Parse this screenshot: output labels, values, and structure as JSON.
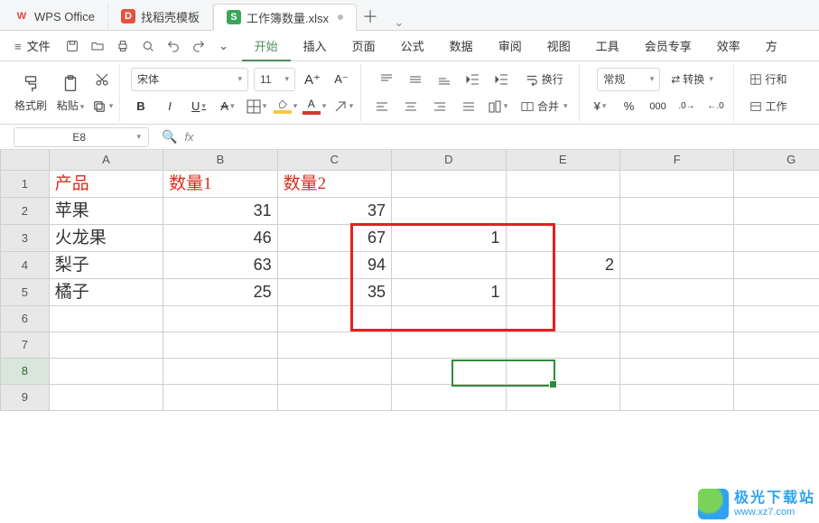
{
  "tabs": {
    "app": {
      "label": "WPS Office"
    },
    "tmpl": {
      "label": "找稻壳模板"
    },
    "sheet": {
      "label": "工作簿数量.xlsx"
    }
  },
  "menubar": {
    "file": "文件",
    "items": [
      "开始",
      "插入",
      "页面",
      "公式",
      "数据",
      "审阅",
      "视图",
      "工具",
      "会员专享",
      "效率",
      "方"
    ]
  },
  "ribbon": {
    "format_painter": "格式刷",
    "paste": "粘贴",
    "font_name": "宋体",
    "font_size": "11",
    "wrap": "换行",
    "merge": "合并",
    "numfmt": "常规",
    "transpose": "转换",
    "rowcol": "行和",
    "worksheet": "工作"
  },
  "namebox": "E8",
  "sheet": {
    "cols": [
      "A",
      "B",
      "C",
      "D",
      "E",
      "F",
      "G"
    ],
    "rows": [
      "1",
      "2",
      "3",
      "4",
      "5",
      "6",
      "7",
      "8",
      "9"
    ],
    "headers": {
      "A1": "产品",
      "B1": "数量1",
      "C1": "数量2"
    },
    "data": {
      "A2": "苹果",
      "B2": "31",
      "C2": "37",
      "A3": "火龙果",
      "B3": "46",
      "C3": "67",
      "D3": "1",
      "A4": "梨子",
      "B4": "63",
      "C4": "94",
      "E4": "2",
      "A5": "橘子",
      "B5": "25",
      "C5": "35",
      "D5": "1"
    }
  },
  "watermark": {
    "name": "极光下载站",
    "url": "www.xz7.com"
  }
}
